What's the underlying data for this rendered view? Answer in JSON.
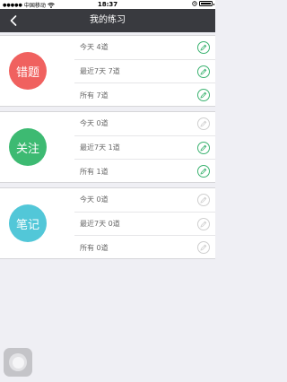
{
  "status_bar": {
    "carrier": "中国移动",
    "time": "18:37"
  },
  "nav": {
    "title": "我的练习"
  },
  "colors": {
    "accent_green": "#3cb371",
    "inactive": "#cfcfcf",
    "wrong_circle": "#f0615f",
    "follow_circle": "#3dba72",
    "notes_circle": "#52c7d8"
  },
  "sections": [
    {
      "name": "错题",
      "color": "#f0615f",
      "rows": [
        {
          "label": "今天 4道",
          "active": true
        },
        {
          "label": "最近7天 7道",
          "active": true
        },
        {
          "label": "所有 7道",
          "active": true
        }
      ]
    },
    {
      "name": "关注",
      "color": "#3dba72",
      "rows": [
        {
          "label": "今天 0道",
          "active": false
        },
        {
          "label": "最近7天 1道",
          "active": true
        },
        {
          "label": "所有 1道",
          "active": true
        }
      ]
    },
    {
      "name": "笔记",
      "color": "#52c7d8",
      "rows": [
        {
          "label": "今天 0道",
          "active": false
        },
        {
          "label": "最近7天 0道",
          "active": false
        },
        {
          "label": "所有 0道",
          "active": false
        }
      ]
    }
  ],
  "icons": {
    "back": "chevron-left-icon",
    "edit": "pencil-icon",
    "assistive": "assistive-touch-icon"
  }
}
